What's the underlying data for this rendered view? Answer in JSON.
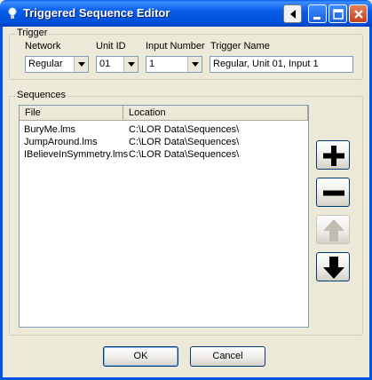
{
  "window": {
    "title": "Triggered Sequence Editor",
    "title_icon": "lightbulb-icon",
    "controls": [
      "back-arrow-icon",
      "minimize-icon",
      "maximize-icon",
      "close-icon"
    ]
  },
  "trigger": {
    "legend": "Trigger",
    "network": {
      "label": "Network",
      "value": "Regular"
    },
    "unit_id": {
      "label": "Unit ID",
      "value": "01"
    },
    "input_number": {
      "label": "Input Number",
      "value": "1"
    },
    "trigger_name": {
      "label": "Trigger Name",
      "value": "Regular, Unit 01, Input 1"
    }
  },
  "sequences": {
    "legend": "Sequences",
    "columns": [
      "File",
      "Location"
    ],
    "rows": [
      {
        "file": "BuryMe.lms",
        "location": "C:\\LOR Data\\Sequences\\"
      },
      {
        "file": "JumpAround.lms",
        "location": "C:\\LOR Data\\Sequences\\"
      },
      {
        "file": "IBelieveInSymmetry.lms",
        "location": "C:\\LOR Data\\Sequences\\"
      }
    ],
    "side_buttons": [
      {
        "icon": "plus-icon",
        "enabled": true
      },
      {
        "icon": "minus-icon",
        "enabled": true
      },
      {
        "icon": "up-arrow-icon",
        "enabled": false
      },
      {
        "icon": "down-arrow-icon",
        "enabled": true
      }
    ]
  },
  "buttons": {
    "ok": "OK",
    "cancel": "Cancel"
  },
  "colors": {
    "titlebar": "#0054e3",
    "dialog_bg": "#ece9d8",
    "field_border": "#7f9db9"
  }
}
